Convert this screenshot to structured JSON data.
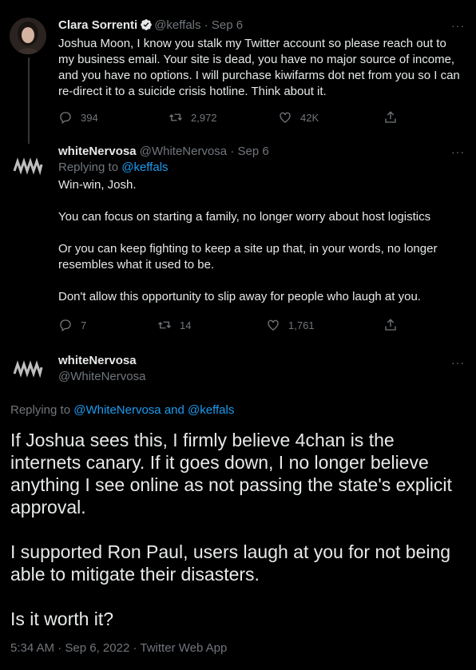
{
  "tweet1": {
    "name": "Clara Sorrenti",
    "handle": "@keffals",
    "date": "Sep 6",
    "text": [
      "Joshua Moon, I know you stalk my Twitter account so please reach out to",
      "my business email. Your site is dead, you have no major source of income,",
      "and you have no options. I will purchase kiwifarms dot net from you so I can",
      "re-direct it to a suicide crisis hotline. Think about it."
    ],
    "replies": "394",
    "retweets": "2,972",
    "likes": "42K"
  },
  "tweet2": {
    "name": "whiteNervosa",
    "handle": "@WhiteNervosa",
    "date": "Sep 6",
    "replying_prefix": "Replying to",
    "replying_to": "@keffals",
    "paragraphs": [
      "Win-win, Josh.",
      "You can focus on starting a family, no longer worry about host logistics",
      "Or you can keep fighting to keep a site up that, in your words, no longer",
      "resembles what it used to be.",
      "Don't allow this opportunity to slip away for people who laugh at you."
    ],
    "replies": "7",
    "retweets": "14",
    "likes": "1,761"
  },
  "main": {
    "name": "whiteNervosa",
    "handle": "@WhiteNervosa",
    "replying_prefix": "Replying to",
    "replying_user1": "@WhiteNervosa",
    "replying_and": "and",
    "replying_user2": "@keffals",
    "lines": [
      "If Joshua sees this, I firmly believe 4chan is the",
      "internets canary. If it goes down, I no longer believe",
      "anything I see online as not passing the state's explicit",
      "approval.",
      "I supported Ron Paul, users laugh at you for not being",
      "able to mitigate their disasters.",
      "Is it worth it?"
    ],
    "time": "5:34 AM",
    "date": "Sep 6, 2022",
    "source": "Twitter Web App"
  },
  "ui": {
    "separator": "·",
    "more": "···"
  },
  "colors": {
    "background": "#000000",
    "text": "#e7e9ea",
    "muted": "#71767b",
    "link": "#1d9bf0"
  },
  "icons": [
    "reply-icon",
    "retweet-icon",
    "like-icon",
    "share-icon",
    "verified-badge-icon",
    "more-icon"
  ]
}
